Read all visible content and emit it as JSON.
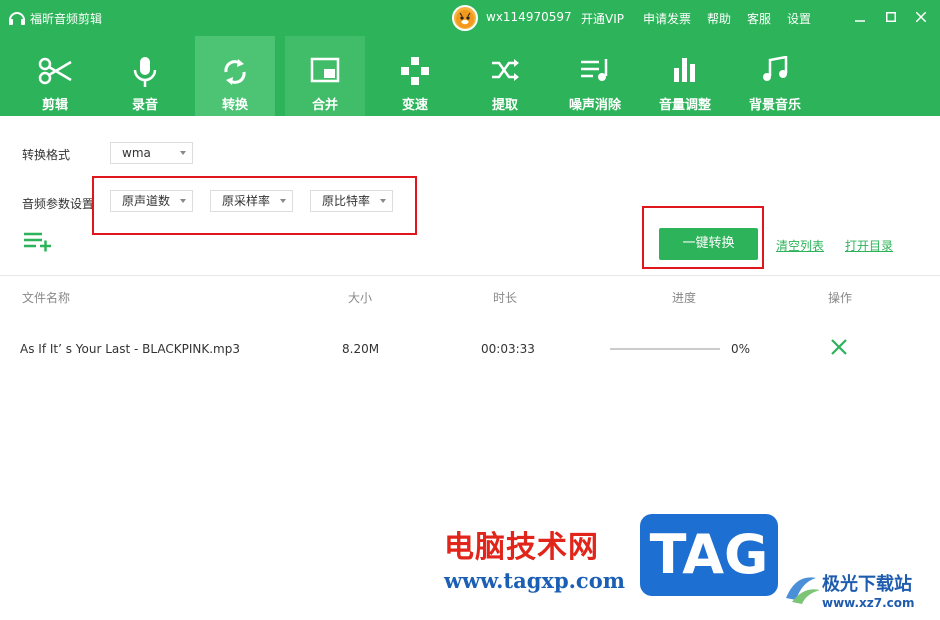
{
  "app": {
    "title": "福昕音频剪辑",
    "user": "wx114970597",
    "links": [
      "开通VIP",
      "申请发票",
      "帮助",
      "客服",
      "设置"
    ]
  },
  "toolbar": {
    "items": [
      {
        "label": "剪辑",
        "icon": "scissors-icon"
      },
      {
        "label": "录音",
        "icon": "microphone-icon"
      },
      {
        "label": "转换",
        "icon": "refresh-icon",
        "active": true
      },
      {
        "label": "合并",
        "icon": "merge-icon"
      },
      {
        "label": "变速",
        "icon": "speed-icon"
      },
      {
        "label": "提取",
        "icon": "shuffle-icon"
      },
      {
        "label": "噪声消除",
        "icon": "noise-icon"
      },
      {
        "label": "音量调整",
        "icon": "volume-bars-icon"
      },
      {
        "label": "背景音乐",
        "icon": "music-note-icon"
      }
    ]
  },
  "settings": {
    "format_label": "转换格式",
    "format_value": "wma",
    "params_label": "音频参数设置",
    "channels_value": "原声道数",
    "samplerate_value": "原采样率",
    "bitrate_value": "原比特率"
  },
  "actions": {
    "convert": "一键转换",
    "clear": "清空列表",
    "open_dir": "打开目录"
  },
  "table": {
    "headers": [
      "文件名称",
      "大小",
      "时长",
      "进度",
      "操作"
    ],
    "rows": [
      {
        "name": "As If It’ s Your Last - BLACKPINK.mp3",
        "size": "8.20M",
        "duration": "00:03:33",
        "progress": "0%",
        "progress_value": 0
      }
    ]
  },
  "watermark": {
    "line1": "电脑技术网",
    "line2": "www.tagxp.com",
    "tag": "TAG",
    "site2_name": "极光下载站",
    "site2_url": "www.xz7.com"
  },
  "colors": {
    "brand": "#2db35a",
    "highlight": "#e0161c"
  }
}
